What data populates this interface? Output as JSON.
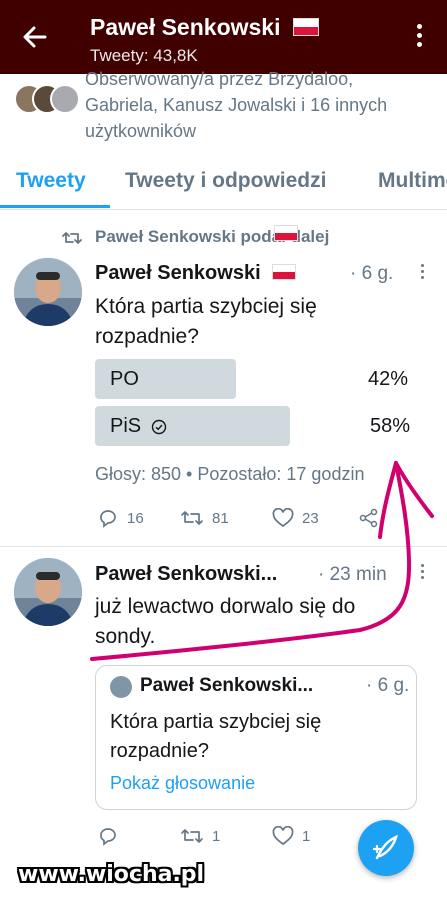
{
  "header": {
    "title": "Paweł Senkowski",
    "subtitle": "Tweety: 43,8K",
    "back_icon": "arrow-left-icon",
    "menu_icon": "more-vertical-icon"
  },
  "followers": {
    "text": "Obserwowany/a przez Brzydaloo, Gabriela, Kanusz Jowalski i 16 innych użytkowników"
  },
  "tabs": [
    {
      "label": "Tweety",
      "active": true
    },
    {
      "label": "Tweety i odpowiedzi",
      "active": false
    },
    {
      "label": "Multimedia",
      "active": false
    }
  ],
  "retweet_context": "Paweł Senkowski  podał dalej",
  "tweet1": {
    "name": "Paweł Senkowski",
    "time": "· 6 g.",
    "text_line1": "Która partia szybciej się",
    "text_line2": "rozpadnie?",
    "poll": [
      {
        "label": "PO",
        "percent": "42%",
        "fraction": 0.42
      },
      {
        "label": "PiS",
        "percent": "58%",
        "fraction": 0.58
      }
    ],
    "poll_meta": "Głosy: 850 • Pozostało: 17 godzin",
    "reply_count": "16",
    "retweet_count": "81",
    "like_count": "23"
  },
  "tweet2": {
    "name": "Paweł Senkowski...",
    "time": "· 23 min",
    "text_line1": "już lewactwo dorwalo się do",
    "text_line2": "sondy.",
    "quote": {
      "name": "Paweł Senkowski...",
      "time": "· 6 g.",
      "text_line1": "Która partia szybciej się",
      "text_line2": "rozpadnie?",
      "link": "Pokaż głosowanie"
    },
    "reply_count": "",
    "retweet_count": "1",
    "like_count": "1"
  },
  "watermark": "www.wiocha.pl",
  "colors": {
    "accent": "#1da1f2",
    "header_bg": "#400000",
    "annotation": "#d0006f"
  }
}
